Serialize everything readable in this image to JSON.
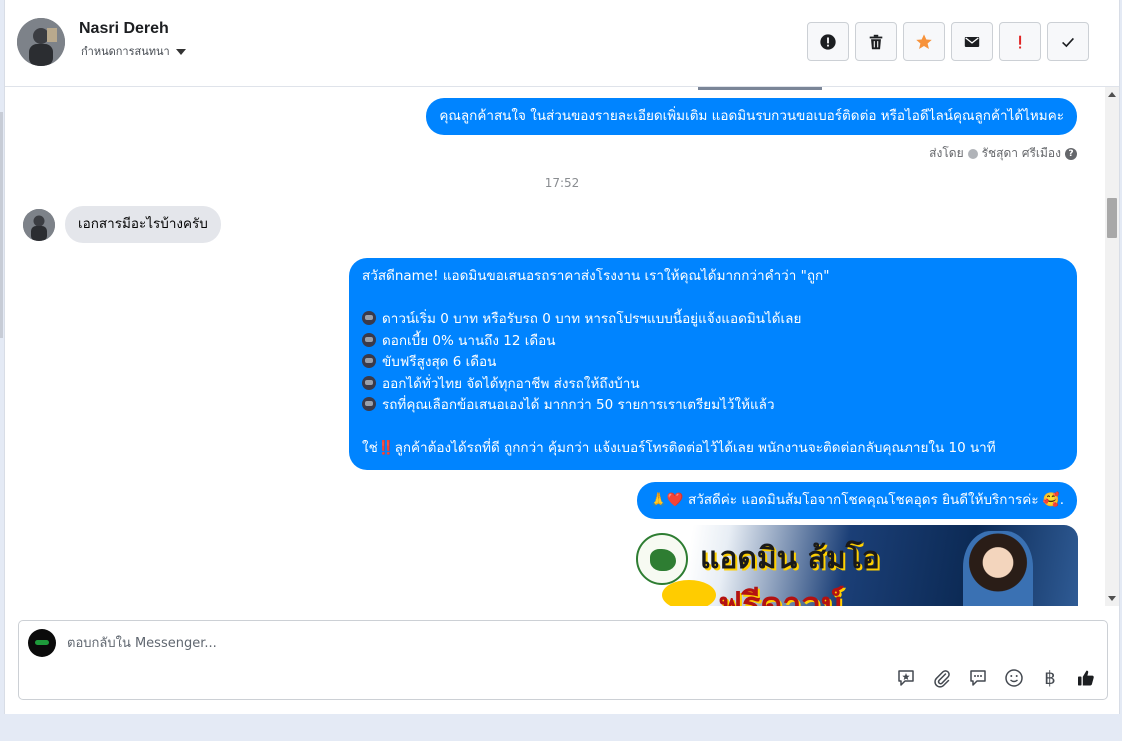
{
  "header": {
    "contact_name": "Nasri Dereh",
    "status_label": "กำหนดการสนทนา",
    "actions": [
      {
        "name": "report-button",
        "icon": "alert-circle-icon"
      },
      {
        "name": "delete-button",
        "icon": "trash-icon"
      },
      {
        "name": "star-button",
        "icon": "star-icon",
        "color": "#f7923a"
      },
      {
        "name": "mail-button",
        "icon": "envelope-icon"
      },
      {
        "name": "spam-button",
        "icon": "exclamation-icon",
        "color": "#e02424"
      },
      {
        "name": "done-button",
        "icon": "check-icon"
      }
    ]
  },
  "conversation": {
    "msg_out_1": "คุณลูกค้าสนใจ ในส่วนของรายละเอียดเพิ่มเติม แอดมินรบกวนขอเบอร์ติดต่อ หรือไอดีไลน์คุณลูกค้าได้ไหมคะ",
    "sent_by_label": "ส่งโดย",
    "sent_by_name": "รัชสุดา ศรีเมือง",
    "time_separator": "17:52",
    "msg_in_1": "เอกสารมีอะไรบ้างครับ",
    "msg_out_2": {
      "line1": "สวัสดีname! แอดมินขอเสนอรถราคาส่งโรงงาน เราให้คุณได้มากกว่าคำว่า \"ถูก\"",
      "bullets": [
        "ดาวน์เริ่ม 0 บาท หรือรับรถ 0 บาท หารถโปรฯแบบนี้อยู่แจ้งแอดมินได้เลย",
        "ดอกเบี้ย 0% นานถึง 12 เดือน",
        "ขับฟรีสูงสุด 6 เดือน",
        "ออกได้ทั่วไทย จัดได้ทุกอาชีพ ส่งรถให้ถึงบ้าน",
        "รถที่คุณเลือกข้อเสนอเองได้ มากกว่า 50 รายการเราเตรียมไว้ให้แล้ว"
      ],
      "closing_prefix": "ใช่",
      "closing_emoji": "‼️",
      "closing_text": "ลูกค้าต้องได้รถที่ดี ถูกกว่า คุ้มกว่า แจ้งเบอร์โทรติดต่อไว้ได้เลย พนักงานจะติดต่อกลับคุณภายใน 10 นาที"
    },
    "msg_out_3": {
      "prefix_emoji": "🙏",
      "heart_emoji": "❤️",
      "text": "สวัสดีค่ะ แอดมินส้มโอจากโชคคุณโชคอุดร ยินดีให้บริการค่ะ",
      "suffix_emoji": "🥰",
      "end": "."
    },
    "image_card": {
      "title": "แอดมิน ส้มโอ",
      "subtitle": "ฟรีดาวน์"
    }
  },
  "composer": {
    "placeholder": "ตอบกลับใน Messenger...",
    "tools": [
      "saved-reply-icon",
      "paperclip-icon",
      "chat-bubble-icon",
      "emoji-icon",
      "baht-icon",
      "thumbs-up-icon"
    ],
    "baht_symbol": "฿"
  },
  "colors": {
    "outgoing_bubble": "#0084ff",
    "incoming_bubble": "#e4e6eb",
    "star": "#f7923a",
    "spam": "#e02424"
  }
}
